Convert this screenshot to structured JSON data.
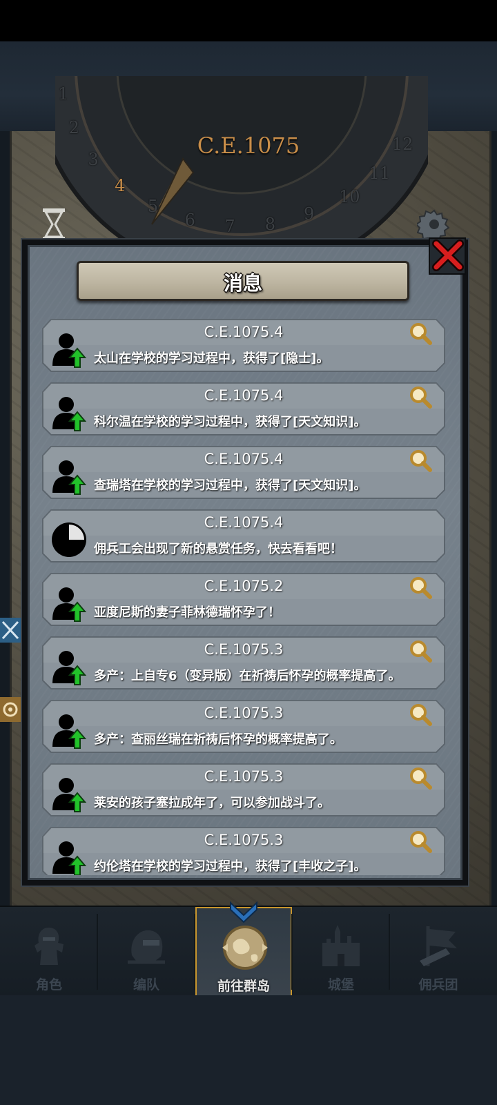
{
  "header": {
    "year": "C.E.1075"
  },
  "dial": {
    "numbers": [
      "1",
      "2",
      "3",
      "4",
      "5",
      "6",
      "7",
      "8",
      "9",
      "10",
      "11",
      "12"
    ],
    "current": "4"
  },
  "modal": {
    "title": "消息"
  },
  "messages": [
    {
      "date": "C.E.1075.4",
      "text": "太山在学校的学习过程中，获得了[隐士]。",
      "icon": "person-up-icon",
      "searchable": true
    },
    {
      "date": "C.E.1075.4",
      "text": "科尔温在学校的学习过程中，获得了[天文知识]。",
      "icon": "person-up-icon",
      "searchable": true
    },
    {
      "date": "C.E.1075.4",
      "text": "查瑞塔在学校的学习过程中，获得了[天文知识]。",
      "icon": "person-up-icon",
      "searchable": true
    },
    {
      "date": "C.E.1075.4",
      "text": "佣兵工会出现了新的悬赏任务，快去看看吧！",
      "icon": "clock-pie-icon",
      "searchable": false
    },
    {
      "date": "C.E.1075.2",
      "text": "亚度尼斯的妻子菲林德瑞怀孕了！",
      "icon": "person-up-icon",
      "searchable": true
    },
    {
      "date": "C.E.1075.3",
      "text": "多产：上自专6（变异版）在祈祷后怀孕的概率提高了。",
      "icon": "person-up-icon",
      "searchable": true
    },
    {
      "date": "C.E.1075.3",
      "text": "多产：查丽丝瑞在祈祷后怀孕的概率提高了。",
      "icon": "person-up-icon",
      "searchable": true
    },
    {
      "date": "C.E.1075.3",
      "text": "莱安的孩子塞拉成年了，可以参加战斗了。",
      "icon": "person-up-icon",
      "searchable": true
    },
    {
      "date": "C.E.1075.3",
      "text": "约伦塔在学校的学习过程中，获得了[丰收之子]。",
      "icon": "person-up-icon",
      "searchable": true
    }
  ],
  "nav": [
    {
      "label": "角色",
      "icon": "knight-icon",
      "active": false
    },
    {
      "label": "编队",
      "icon": "helmet-icon",
      "active": false
    },
    {
      "label": "前往群岛",
      "icon": "globe-icon",
      "active": true
    },
    {
      "label": "城堡",
      "icon": "castle-icon",
      "active": false
    },
    {
      "label": "佣兵团",
      "icon": "banner-icon",
      "active": false
    }
  ],
  "colors": {
    "accent": "#c8962d",
    "year": "#c98e49",
    "arrow": "#22c22a",
    "close": "#d81e1e"
  }
}
